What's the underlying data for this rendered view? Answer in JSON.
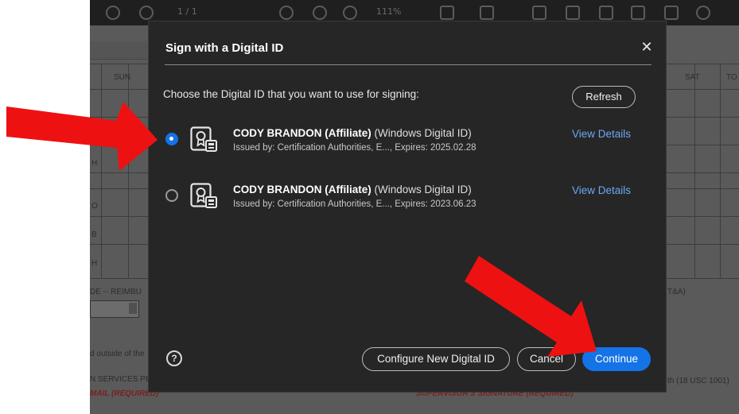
{
  "background": {
    "toolbar": {
      "page_indicator": "1 / 1",
      "zoom": "111%"
    },
    "labels": {
      "sun": "SUN",
      "sat": "SAT",
      "to": "TO",
      "row_o": "O",
      "row_b": "B",
      "row_h1": "H",
      "row_h2": "H",
      "de_reimbu": "DE -- REIMBU",
      "t_and_a": "T&A)",
      "outside": "d outside of the",
      "services": "N SERVICES PE",
      "usc": "th (18 USC 1001)",
      "mail_required": "MAIL  (REQUIRED)",
      "signature_required": "SUPERVISOR'S SIGNATURE  (REQUIRED)"
    }
  },
  "dialog": {
    "title": "Sign with a Digital ID",
    "close_glyph": "✕",
    "prompt": "Choose the Digital ID that you want to use for signing:",
    "refresh_label": "Refresh",
    "ids": [
      {
        "selected": true,
        "name": "CODY BRANDON (Affiliate)",
        "type": "(Windows Digital ID)",
        "issued": "Issued by: Certification Authorities, E..., Expires: 2025.02.28",
        "view_label": "View Details"
      },
      {
        "selected": false,
        "name": "CODY BRANDON (Affiliate)",
        "type": "(Windows Digital ID)",
        "issued": "Issued by: Certification Authorities, E..., Expires: 2023.06.23",
        "view_label": "View Details"
      }
    ],
    "help_glyph": "?",
    "configure_label": "Configure New Digital ID",
    "cancel_label": "Cancel",
    "continue_label": "Continue"
  },
  "colors": {
    "accent": "#1473e6",
    "link": "#6aa9f2",
    "dialog_bg": "#262626",
    "annotation_arrow": "#ee1111"
  },
  "icons": {
    "certificate": "certificate-icon",
    "help": "help-icon",
    "close": "close-icon",
    "arrow": "red-arrow-annotation"
  }
}
